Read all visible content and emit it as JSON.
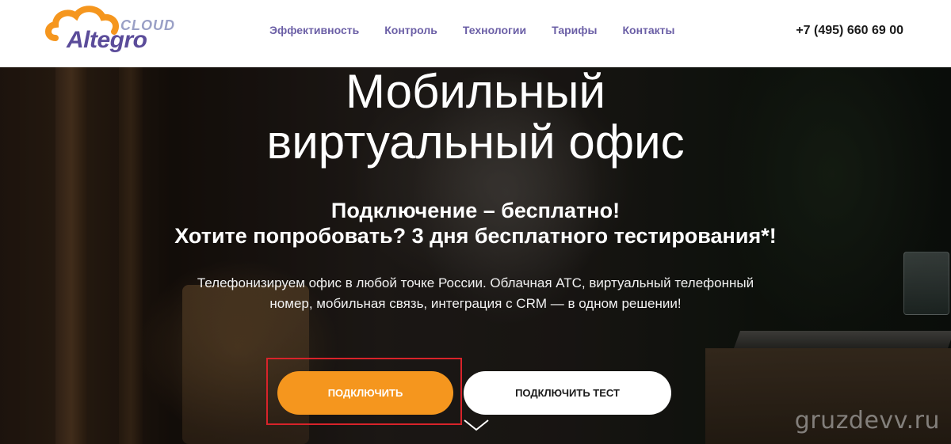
{
  "header": {
    "logo_cloud": "CLOUD",
    "logo_brand": "Altegro",
    "nav": [
      "Эффективность",
      "Контроль",
      "Технологии",
      "Тарифы",
      "Контакты"
    ],
    "phone": "+7 (495) 660 69 00"
  },
  "hero": {
    "title_line1": "Мобильный",
    "title_line2": "виртуальный офис",
    "subtitle_line1": "Подключение – бесплатно!",
    "subtitle_line2": "Хотите попробовать? 3 дня бесплатного тестирования*!",
    "desc_line1": "Телефонизируем офис в любой точке России. Облачная АТС, виртуальный телефонный",
    "desc_line2": "номер, мобильная связь, интеграция с CRM — в одном решении!",
    "primary_button": "ПОДКЛЮЧИТЬ",
    "secondary_button": "ПОДКЛЮЧИТЬ ТЕСТ",
    "scroll_icon": "chevron-down-icon"
  },
  "watermark": "gruzdevv.ru",
  "colors": {
    "accent": "#f5961e",
    "nav": "#6b5fa6",
    "brand": "#5b4c9a",
    "highlight": "#d8232a"
  }
}
